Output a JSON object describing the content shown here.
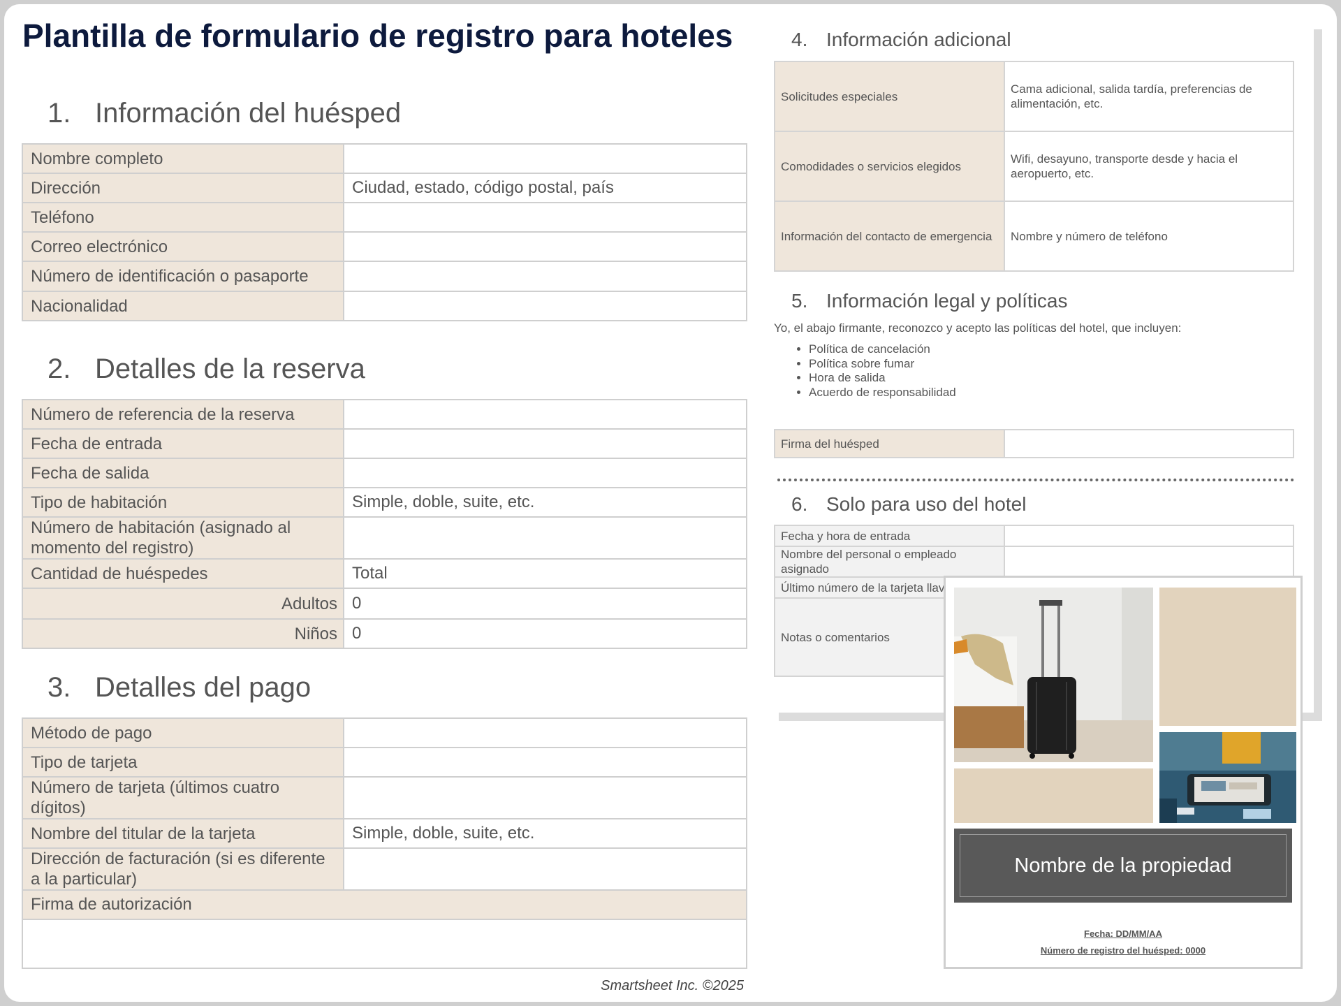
{
  "title": "Plantilla de formulario de registro para hoteles",
  "guest": {
    "num": "1.",
    "heading": "Información del huésped",
    "rows": [
      {
        "label": "Nombre completo",
        "value": ""
      },
      {
        "label": "Dirección",
        "value": "Ciudad, estado, código postal, país"
      },
      {
        "label": "Teléfono",
        "value": ""
      },
      {
        "label": "Correo electrónico",
        "value": ""
      },
      {
        "label": "Número de identificación o pasaporte",
        "value": ""
      },
      {
        "label": "Nacionalidad",
        "value": ""
      }
    ]
  },
  "booking": {
    "num": "2.",
    "heading": "Detalles de la reserva",
    "rows": [
      {
        "label": "Número de referencia de la reserva",
        "value": ""
      },
      {
        "label": "Fecha de entrada",
        "value": ""
      },
      {
        "label": "Fecha de salida",
        "value": ""
      },
      {
        "label": "Tipo de habitación",
        "value": "Simple, doble, suite, etc."
      },
      {
        "label": "Número de habitación (asignado al momento del registro)",
        "value": ""
      },
      {
        "label": "Cantidad de huéspedes",
        "value": "Total"
      },
      {
        "label": "Adultos",
        "value": "0"
      },
      {
        "label": "Niños",
        "value": "0"
      }
    ]
  },
  "payment": {
    "num": "3.",
    "heading": "Detalles del pago",
    "rows": [
      {
        "label": "Método de pago",
        "value": ""
      },
      {
        "label": "Tipo de tarjeta",
        "value": ""
      },
      {
        "label": "Número de tarjeta (últimos cuatro dígitos)",
        "value": ""
      },
      {
        "label": "Nombre del titular de la tarjeta",
        "value": "Simple, doble, suite, etc."
      },
      {
        "label": "Dirección de facturación (si es diferente a la particular)",
        "value": ""
      }
    ],
    "signature_label": "Firma de autorización"
  },
  "additional": {
    "num": "4.",
    "heading": "Información adicional",
    "rows": [
      {
        "label": "Solicitudes especiales",
        "value": "Cama adicional, salida tardía, preferencias de alimentación, etc."
      },
      {
        "label": "Comodidades o servicios elegidos",
        "value": "Wifi, desayuno, transporte desde y hacia el aeropuerto, etc."
      },
      {
        "label": "Información del contacto de emergencia",
        "value": "Nombre y número de teléfono"
      }
    ]
  },
  "legal": {
    "num": "5.",
    "heading": "Información legal y políticas",
    "intro": "Yo, el abajo firmante, reconozco y acepto las políticas del hotel, que incluyen:",
    "items": [
      "Política de cancelación",
      "Política sobre fumar",
      "Hora de salida",
      "Acuerdo de responsabilidad"
    ],
    "signature_label": "Firma del huésped"
  },
  "hotel_use": {
    "num": "6.",
    "heading": "Solo para uso del hotel",
    "rows": [
      {
        "label": "Fecha y hora de entrada"
      },
      {
        "label": "Nombre del personal o empleado asignado"
      },
      {
        "label": "Último número de la tarjeta llave"
      },
      {
        "label": "Notas o comentarios"
      }
    ]
  },
  "cover": {
    "property_name": "Nombre de la propiedad",
    "date_line": "Fecha: DD/MM/AA",
    "registration_line": "Número de registro del huésped: 0000"
  },
  "footer": "Smartsheet Inc. ©2025"
}
